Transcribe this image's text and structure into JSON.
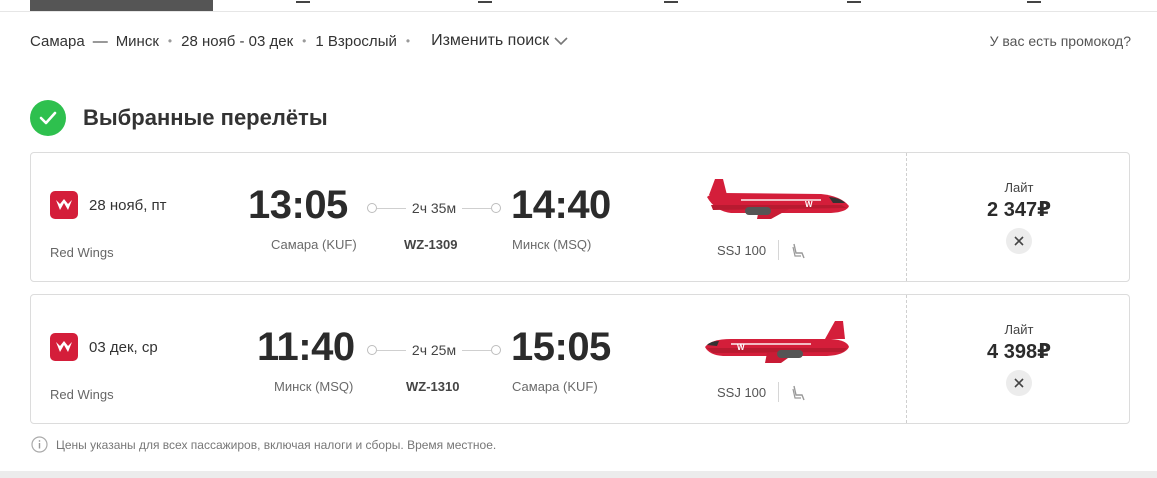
{
  "search": {
    "origin": "Самара",
    "dash": "—",
    "destination": "Минск",
    "dates": "28 нояб - 03 дек",
    "passengers": "1 Взрослый",
    "change_label": "Изменить поиск",
    "promo_label": "У вас есть промокод?"
  },
  "section": {
    "title": "Выбранные перелёты"
  },
  "flights": [
    {
      "date": "28 нояб, пт",
      "airline": "Red Wings",
      "departure_time": "13:05",
      "departure_airport": "Самара (KUF)",
      "duration": "2ч 35м",
      "flight_number": "WZ-1309",
      "arrival_time": "14:40",
      "arrival_airport": "Минск (MSQ)",
      "aircraft": "SSJ 100",
      "fare_name": "Лайт",
      "price": "2 347₽"
    },
    {
      "date": "03 дек, ср",
      "airline": "Red Wings",
      "departure_time": "11:40",
      "departure_airport": "Минск (MSQ)",
      "duration": "2ч 25м",
      "flight_number": "WZ-1310",
      "arrival_time": "15:05",
      "arrival_airport": "Самара (KUF)",
      "aircraft": "SSJ 100",
      "fare_name": "Лайт",
      "price": "4 398₽"
    }
  ],
  "footnote": "Цены указаны для всех пассажиров, включая налоги и сборы. Время местное.",
  "colors": {
    "brand_red": "#d41e3a",
    "check_green": "#2ec04e"
  },
  "icons": {
    "check": "check-icon",
    "chevron": "chevron-down-icon",
    "remove": "close-icon",
    "seat": "seat-icon",
    "info": "info-icon",
    "logo": "red-wings-logo-icon",
    "plane": "airplane-icon"
  }
}
